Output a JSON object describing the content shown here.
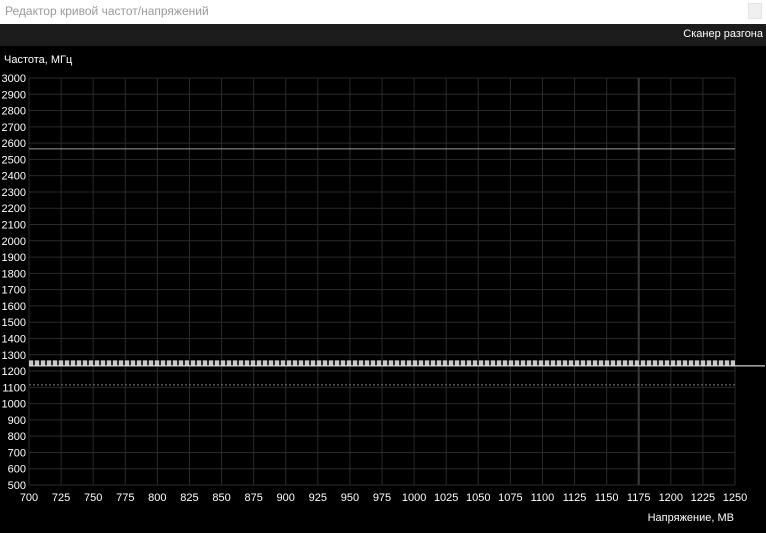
{
  "window": {
    "title": "Редактор кривой частот/напряжений"
  },
  "toolbar": {
    "scanner_label": "Сканер разгона"
  },
  "chart_data": {
    "type": "line",
    "ylabel": "Частота, МГц",
    "xlabel": "Напряжение, МВ",
    "xlim": [
      700,
      1250
    ],
    "ylim": [
      500,
      3000
    ],
    "x_ticks": [
      700,
      725,
      750,
      775,
      800,
      825,
      850,
      875,
      900,
      925,
      950,
      975,
      1000,
      1025,
      1050,
      1075,
      1100,
      1125,
      1150,
      1175,
      1200,
      1225,
      1250
    ],
    "y_ticks": [
      500,
      600,
      700,
      800,
      900,
      1000,
      1100,
      1200,
      1300,
      1400,
      1500,
      1600,
      1700,
      1800,
      1900,
      2000,
      2100,
      2200,
      2300,
      2400,
      2500,
      2600,
      2700,
      2800,
      2900,
      3000
    ],
    "grid": true,
    "series": [
      {
        "style": "thin-line",
        "y": 2565,
        "x_range": [
          700,
          1250
        ]
      },
      {
        "style": "dashed-band",
        "y": 1250,
        "x_range": [
          700,
          1250
        ]
      },
      {
        "style": "dotted-line",
        "y": 1115,
        "x_range": [
          700,
          1250
        ]
      }
    ],
    "markers": [
      {
        "style": "vertical-line",
        "x": 1175
      }
    ],
    "colors": {
      "background": "#000000",
      "grid": "#2a2a2a",
      "line": "#9a9a9a",
      "band": "#c8c8c8",
      "text": "#ffffff"
    }
  }
}
